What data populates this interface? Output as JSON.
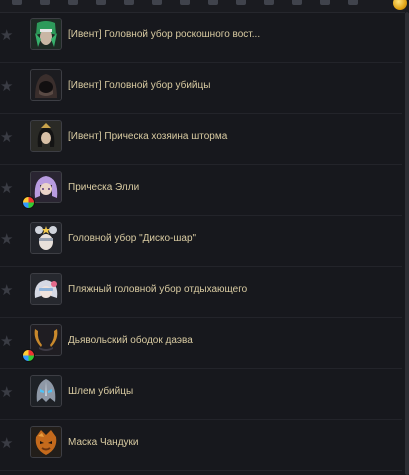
{
  "items": [
    {
      "label": "[Ивент] Головной убор роскошного вост...",
      "icon": "green-oriental-headdress-icon",
      "dye": false
    },
    {
      "label": "[Ивент] Головной убор убийцы",
      "icon": "assassin-hood-icon",
      "dye": false
    },
    {
      "label": "[Ивент] Прическа хозяина шторма",
      "icon": "storm-master-hairstyle-icon",
      "dye": false
    },
    {
      "label": "Прическа Элли",
      "icon": "elli-hairstyle-icon",
      "dye": true
    },
    {
      "label": "Головной убор \"Диско-шар\"",
      "icon": "disco-ball-headdress-icon",
      "dye": false
    },
    {
      "label": "Пляжный головной убор отдыхающего",
      "icon": "beach-hat-icon",
      "dye": false
    },
    {
      "label": "Дьявольский ободок даэва",
      "icon": "devil-horns-headband-icon",
      "dye": true
    },
    {
      "label": "Шлем убийцы",
      "icon": "assassin-helmet-icon",
      "dye": false
    },
    {
      "label": "Маска Чандуки",
      "icon": "chanduki-mask-icon",
      "dye": false
    }
  ],
  "colors": {
    "background": "#17181d",
    "text": "#d9cba2",
    "star": "#3a3c44",
    "gold": "#e0a316"
  }
}
